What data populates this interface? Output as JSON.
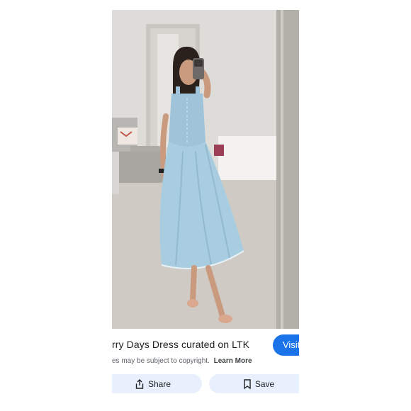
{
  "result": {
    "caption": "rry Days Dress curated on LTK",
    "visit_label": "Visit",
    "copyright_text": "es may be subject to copyright.",
    "learn_more_label": "Learn More"
  },
  "actions": {
    "share_label": "Share",
    "save_label": "Save"
  },
  "colors": {
    "accent": "#1a73e8",
    "action_bg": "#e8f0fe"
  },
  "icons": {
    "share": "share-icon",
    "save": "bookmark-icon"
  }
}
